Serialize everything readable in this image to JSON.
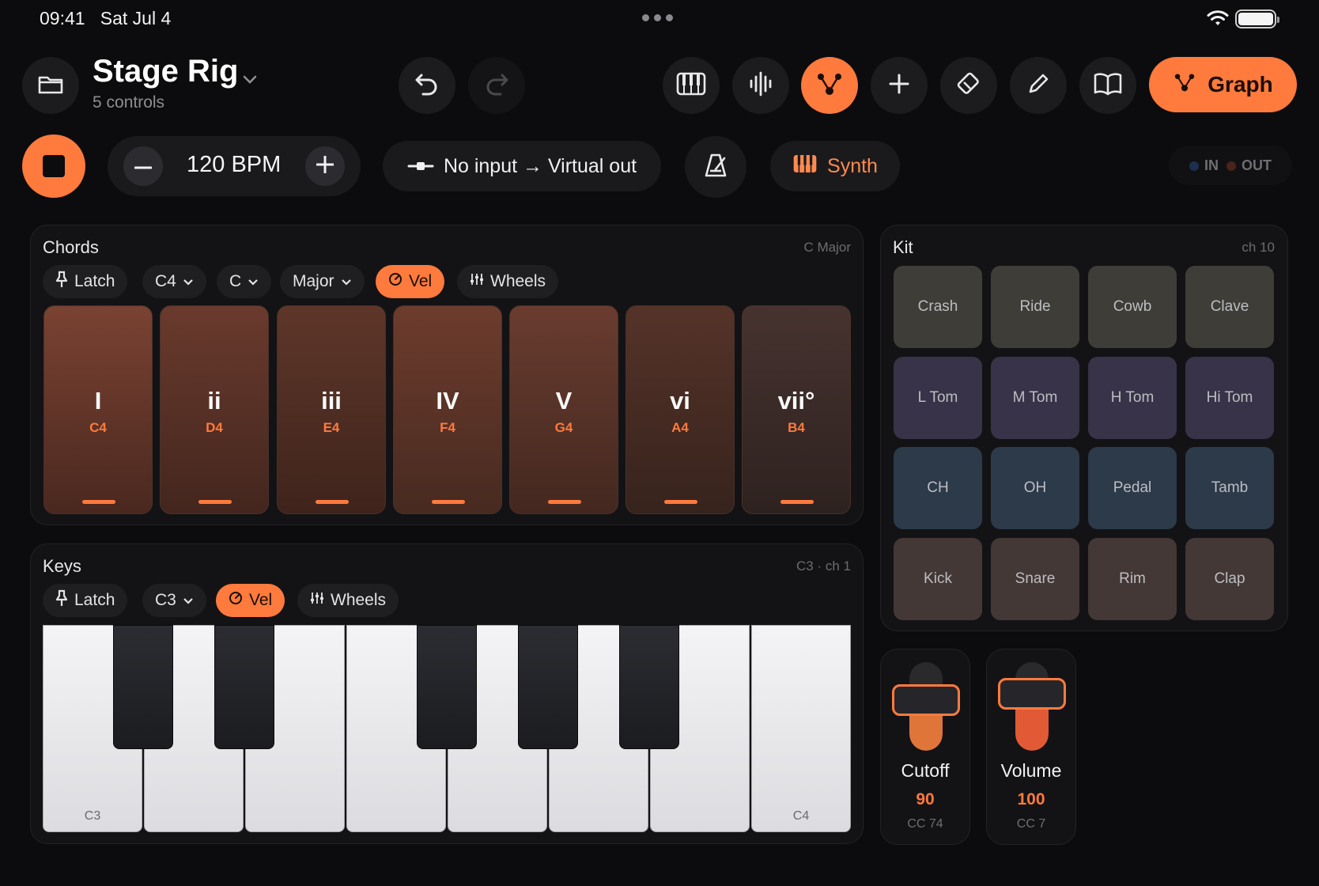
{
  "status": {
    "time": "09:41",
    "date": "Sat Jul 4"
  },
  "header": {
    "title": "Stage Rig",
    "subtitle": "5 controls",
    "graph_label": "Graph"
  },
  "transport": {
    "bpm_label": "120 BPM",
    "io_label": "No input → Virtual out",
    "synth_label": "Synth",
    "in_label": "IN",
    "out_label": "OUT"
  },
  "chords": {
    "title": "Chords",
    "meta": "C Major",
    "latch": "Latch",
    "octave": "C4",
    "root": "C",
    "scale": "Major",
    "vel": "Vel",
    "wheels": "Wheels",
    "pads": [
      {
        "roman": "I",
        "note": "C4"
      },
      {
        "roman": "ii",
        "note": "D4"
      },
      {
        "roman": "iii",
        "note": "E4"
      },
      {
        "roman": "IV",
        "note": "F4"
      },
      {
        "roman": "V",
        "note": "G4"
      },
      {
        "roman": "vi",
        "note": "A4"
      },
      {
        "roman": "vii°",
        "note": "B4"
      }
    ]
  },
  "kit": {
    "title": "Kit",
    "meta": "ch 10",
    "pads": [
      "Crash",
      "Ride",
      "Cowb",
      "Clave",
      "L Tom",
      "M Tom",
      "H Tom",
      "Hi Tom",
      "CH",
      "OH",
      "Pedal",
      "Tamb",
      "Kick",
      "Snare",
      "Rim",
      "Clap"
    ]
  },
  "keys": {
    "title": "Keys",
    "meta": "C3 · ch 1",
    "latch": "Latch",
    "octave": "C3",
    "vel": "Vel",
    "wheels": "Wheels",
    "label_low": "C3",
    "label_high": "C4"
  },
  "faders": [
    {
      "name": "Cutoff",
      "value": "90",
      "cc": "CC 74",
      "level": 0.71,
      "color": "#e0753a"
    },
    {
      "name": "Volume",
      "value": "100",
      "cc": "CC 7",
      "level": 0.79,
      "color": "#e25a35"
    }
  ],
  "colors": {
    "accent": "#ff7a3d",
    "background": "#0c0c0e",
    "panel": "#131315"
  }
}
